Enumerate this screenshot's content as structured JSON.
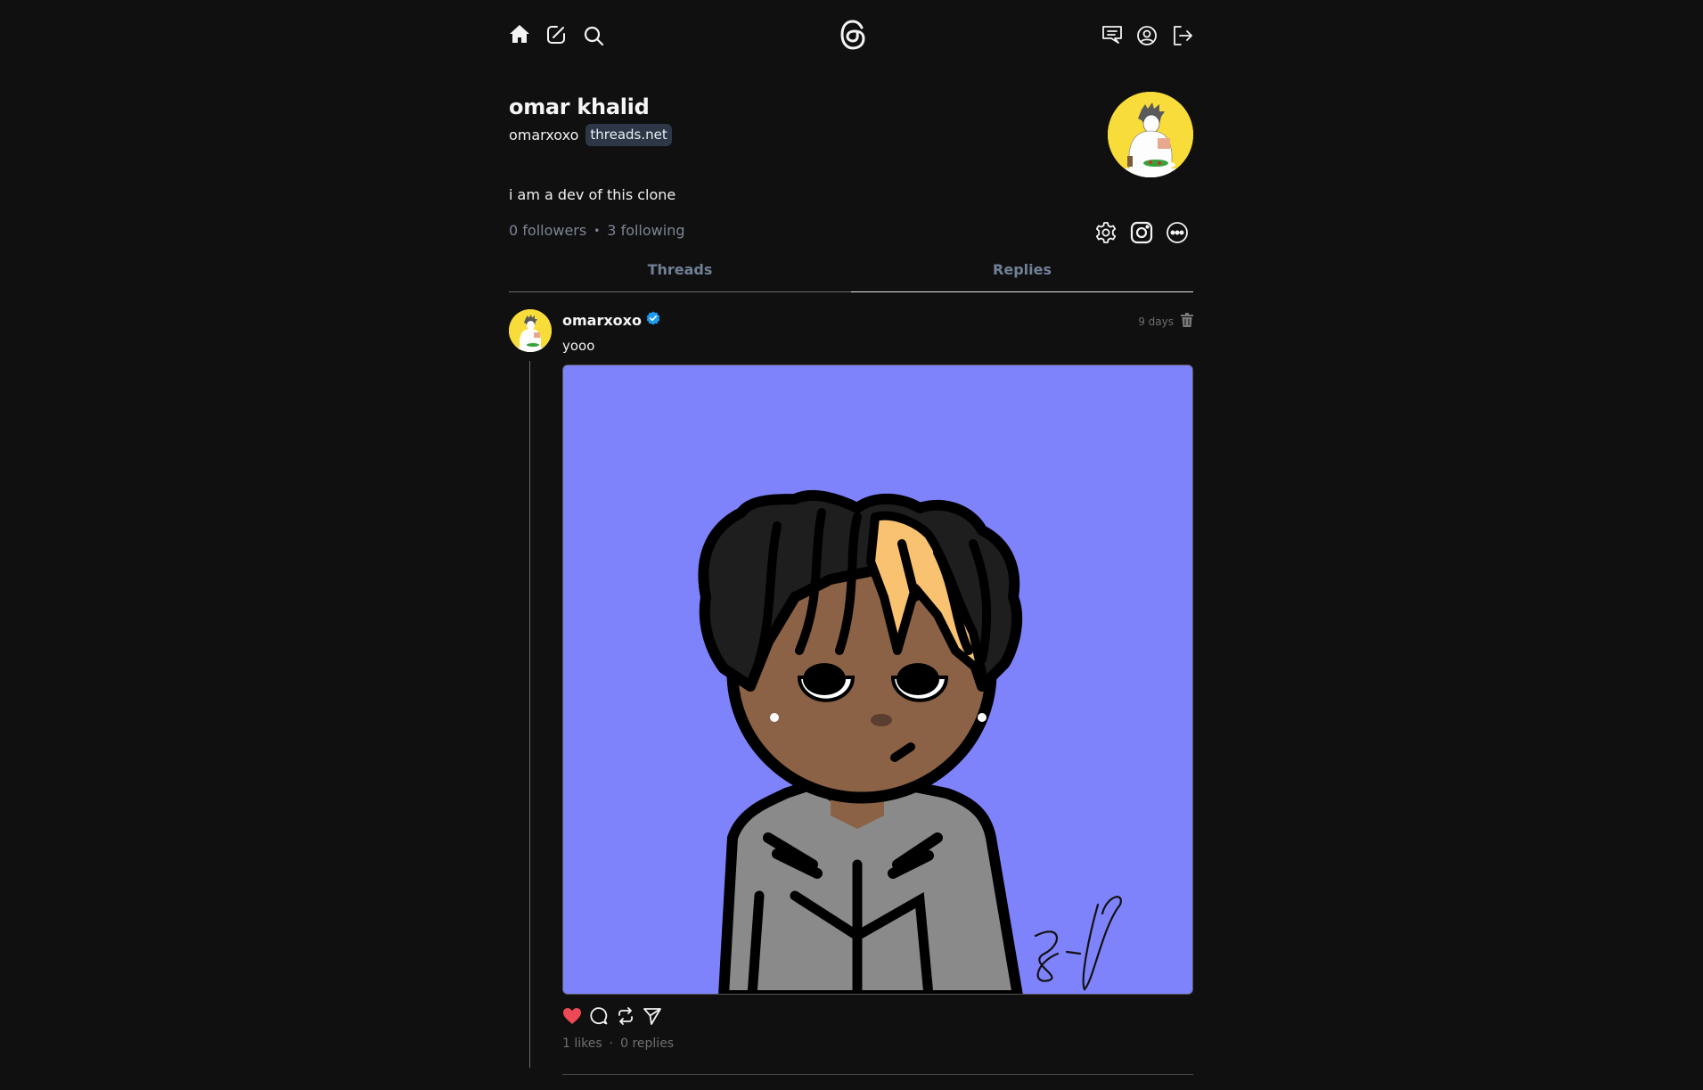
{
  "nav": {
    "left_icons": [
      "home-icon",
      "create-post-icon",
      "search-icon"
    ],
    "logo": "threads-logo",
    "right_icons": [
      "chat-icon",
      "profile-icon",
      "logout-icon"
    ]
  },
  "profile": {
    "name": "omar khalid",
    "username": "omarxoxo",
    "domain_badge": "threads.net",
    "bio": "i am a dev of this clone",
    "followers": "0 followers",
    "separator": "•",
    "following": "3 following",
    "actions": [
      "settings-icon",
      "instagram-icon",
      "more-icon"
    ]
  },
  "tabs": [
    {
      "label": "Threads",
      "active": false
    },
    {
      "label": "Replies",
      "active": true
    }
  ],
  "posts": [
    {
      "username": "omarxoxo",
      "verified": true,
      "time": "9 days",
      "text": "yooo",
      "image_description": "cartoon avatar with curly black and blonde hair, gray hoodie, on a periwinkle background, signed",
      "liked": true,
      "likes": "1 likes",
      "separator": "·",
      "replies": "0 replies"
    }
  ],
  "colors": {
    "background": "#101010",
    "badge_bg": "#2d3748",
    "tab_text": "#718096",
    "like_red": "#ed4956",
    "verified_blue": "#1d9bf0",
    "avatar_yellow": "#f8dc3a",
    "image_bg": "#7f83fb"
  }
}
